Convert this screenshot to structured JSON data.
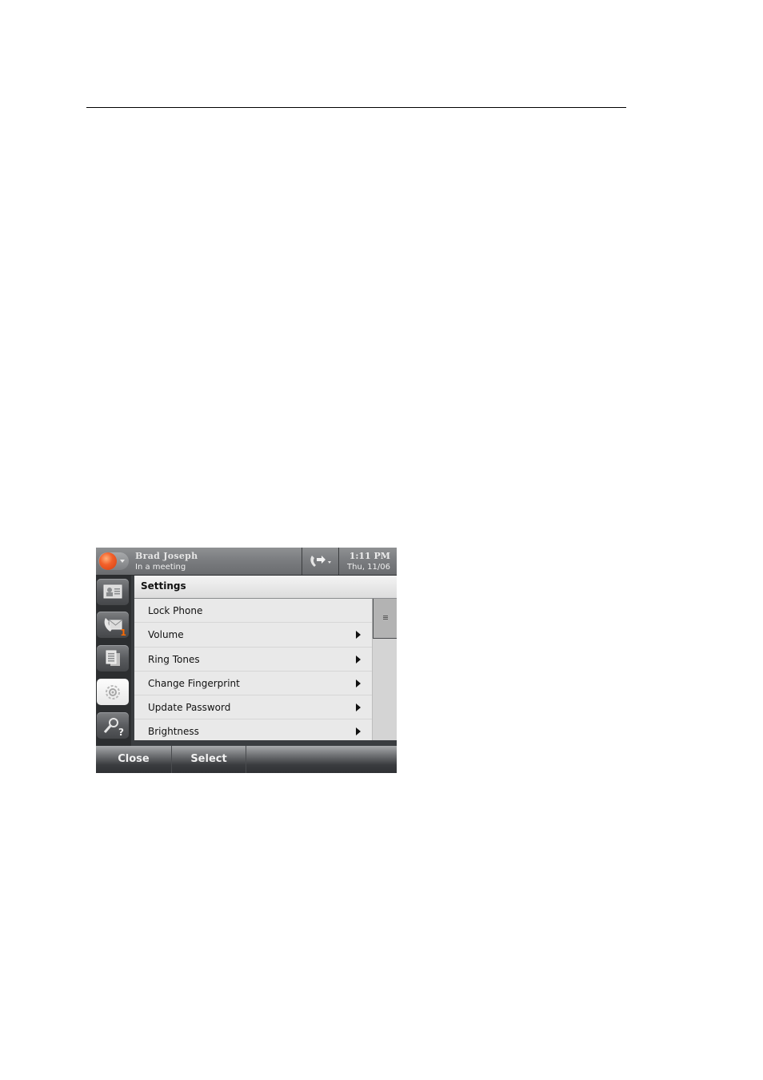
{
  "header": {
    "user_name": "Brad Joseph",
    "user_status": "In a meeting",
    "presence_color": "#f2602a",
    "time": "1:11 PM",
    "date": "Thu, 11/06"
  },
  "nav": {
    "items": [
      {
        "name": "contacts",
        "icon": "contact-card-icon",
        "active": false
      },
      {
        "name": "messages",
        "icon": "phone-envelope-icon",
        "badge": "1",
        "active": false
      },
      {
        "name": "directory",
        "icon": "document-list-icon",
        "active": false
      },
      {
        "name": "settings",
        "icon": "gear-icon",
        "active": true
      },
      {
        "name": "search-help",
        "icon": "magnifier-question-icon",
        "active": false
      }
    ]
  },
  "content": {
    "title": "Settings",
    "items": [
      {
        "label": "Lock Phone",
        "has_submenu": false
      },
      {
        "label": "Volume",
        "has_submenu": true
      },
      {
        "label": "Ring Tones",
        "has_submenu": true
      },
      {
        "label": "Change Fingerprint",
        "has_submenu": true
      },
      {
        "label": "Update Password",
        "has_submenu": true
      },
      {
        "label": "Brightness",
        "has_submenu": true
      }
    ]
  },
  "softkeys": {
    "close": "Close",
    "select": "Select"
  },
  "colors": {
    "badge": "#ff6a00"
  }
}
